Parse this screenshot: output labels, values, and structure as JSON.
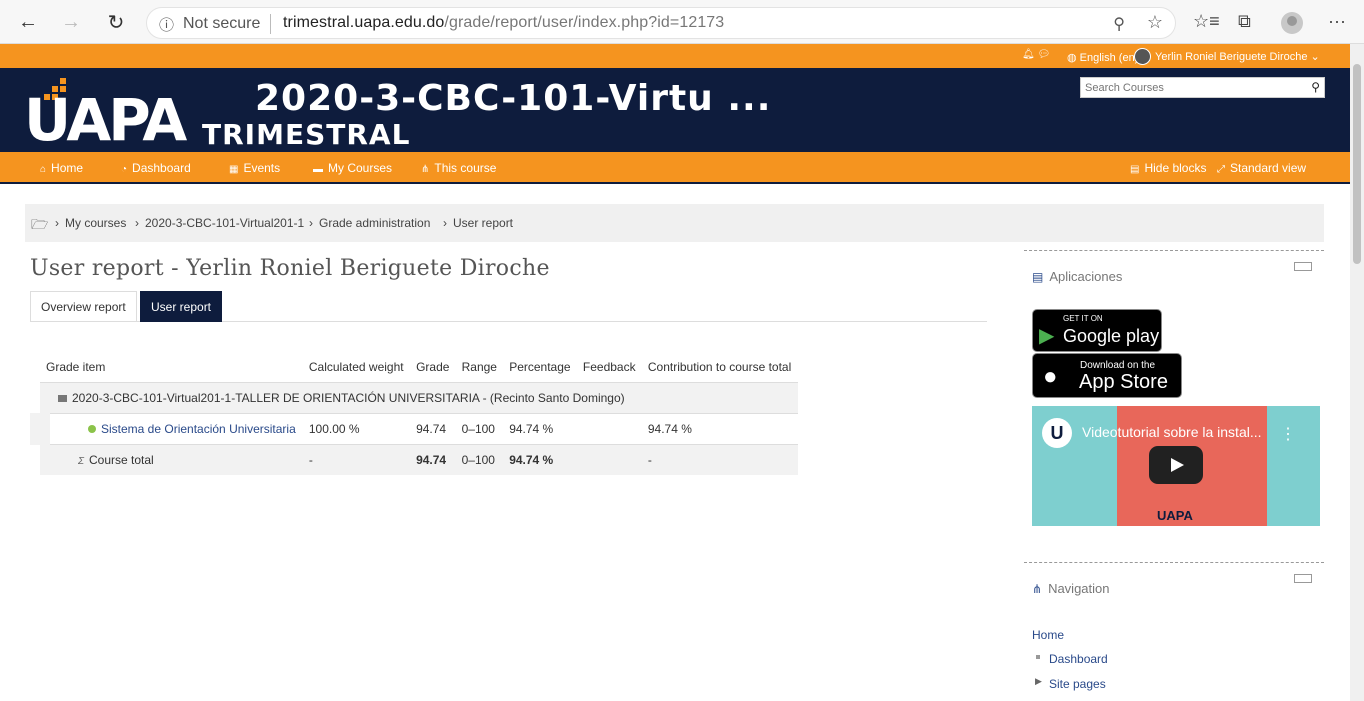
{
  "browser": {
    "security_label": "Not secure",
    "url_host": "trimestral.uapa.edu.do",
    "url_path": "/grade/report/user/index.php?id=12173"
  },
  "topbar": {
    "language": "English (en)",
    "username": "Yerlin Roniel Beriguete Diroche"
  },
  "header": {
    "logo": "UAPA",
    "logo_sub": "TRIMESTRAL",
    "course_title": "2020-3-CBC-101-Virtu ...",
    "search_placeholder": "Search Courses"
  },
  "navbar": {
    "items": [
      "Home",
      "Dashboard",
      "Events",
      "My Courses",
      "This course"
    ],
    "hide_blocks": "Hide blocks",
    "standard_view": "Standard view"
  },
  "breadcrumb": [
    "My courses",
    "2020-3-CBC-101-Virtual201-1",
    "Grade administration",
    "User report"
  ],
  "page_title": "User report - Yerlin Roniel Beriguete Diroche",
  "tabs": [
    "Overview report",
    "User report"
  ],
  "table": {
    "headers": [
      "Grade item",
      "Calculated weight",
      "Grade",
      "Range",
      "Percentage",
      "Feedback",
      "Contribution to course total"
    ],
    "category": "2020-3-CBC-101-Virtual201-1-TALLER DE ORIENTACIÓN UNIVERSITARIA - (Recinto Santo Domingo)",
    "item": {
      "name": "Sistema de Orientación Universitaria",
      "weight": "100.00 %",
      "grade": "94.74",
      "range": "0–100",
      "percentage": "94.74 %",
      "feedback": "",
      "contribution": "94.74 %"
    },
    "total": {
      "symbol": "Σ",
      "name": "Course total",
      "weight": "-",
      "grade": "94.74",
      "range": "0–100",
      "percentage": "94.74 %",
      "feedback": "",
      "contribution": "-"
    }
  },
  "aplicaciones": {
    "title": "Aplicaciones",
    "google_small": "GET IT ON",
    "google_big": "Google play",
    "apple_small": "Download on the",
    "apple_big": "App Store",
    "video_title": "Videotutorial sobre la instal...",
    "video_brand": "UAPA"
  },
  "navigation": {
    "title": "Navigation",
    "home": "Home",
    "dashboard": "Dashboard",
    "site_pages": "Site pages"
  }
}
